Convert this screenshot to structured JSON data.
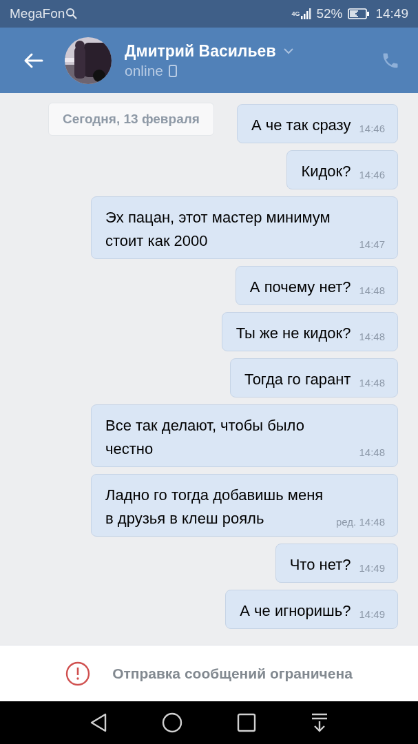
{
  "status_bar": {
    "carrier": "MegaFon",
    "network": "4G",
    "battery": "52%",
    "time": "14:49"
  },
  "header": {
    "name": "Дмитрий Васильев",
    "presence": "online"
  },
  "date_divider": "Сегодня, 13 февраля",
  "messages": [
    {
      "text": "А че так сразу",
      "time": "14:46"
    },
    {
      "text": "Кидок?",
      "time": "14:46"
    },
    {
      "text": "Эх пацан, этот мастер минимум стоит как 2000",
      "time": "14:47"
    },
    {
      "text": "А почему нет?",
      "time": "14:48"
    },
    {
      "text": "Ты же не кидок?",
      "time": "14:48"
    },
    {
      "text": "Тогда го гарант",
      "time": "14:48"
    },
    {
      "text": "Все так делают, чтобы было честно",
      "time": "14:48"
    },
    {
      "text": "Ладно го тогда добавишь меня в друзья в клеш рояль",
      "time": "ред. 14:48"
    },
    {
      "text": "Что нет?",
      "time": "14:49"
    },
    {
      "text": "А че игноришь?",
      "time": "14:49"
    }
  ],
  "notice": "Отправка сообщений ограничена"
}
